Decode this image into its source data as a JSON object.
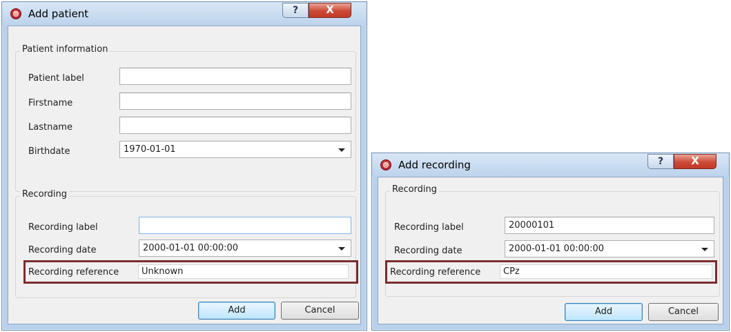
{
  "add_patient": {
    "title": "Add patient",
    "help_glyph": "?",
    "close_glyph": "X",
    "patient_group_title": "Patient information",
    "fields": {
      "patient_label": {
        "label": "Patient label",
        "value": ""
      },
      "firstname": {
        "label": "Firstname",
        "value": ""
      },
      "lastname": {
        "label": "Lastname",
        "value": ""
      },
      "birthdate": {
        "label": "Birthdate",
        "value": "1970-01-01"
      }
    },
    "recording_group_title": "Recording",
    "recording_label": {
      "label": "Recording label",
      "value": ""
    },
    "recording_date": {
      "label": "Recording date",
      "value": "2000-01-01 00:00:00"
    },
    "recording_reference": {
      "label": "Recording reference",
      "value": "Unknown"
    },
    "add_button": "Add",
    "cancel_button": "Cancel"
  },
  "add_recording": {
    "title": "Add recording",
    "help_glyph": "?",
    "close_glyph": "X",
    "recording_group_title": "Recording",
    "recording_label": {
      "label": "Recording label",
      "value": "20000101"
    },
    "recording_date": {
      "label": "Recording date",
      "value": "2000-01-01 00:00:00"
    },
    "recording_reference": {
      "label": "Recording reference",
      "value": "CPz"
    },
    "add_button": "Add",
    "cancel_button": "Cancel"
  },
  "colors": {
    "highlight_border": "#7b2c2c",
    "title_bar": "#bcd3ec",
    "close_button": "#c13a26"
  }
}
